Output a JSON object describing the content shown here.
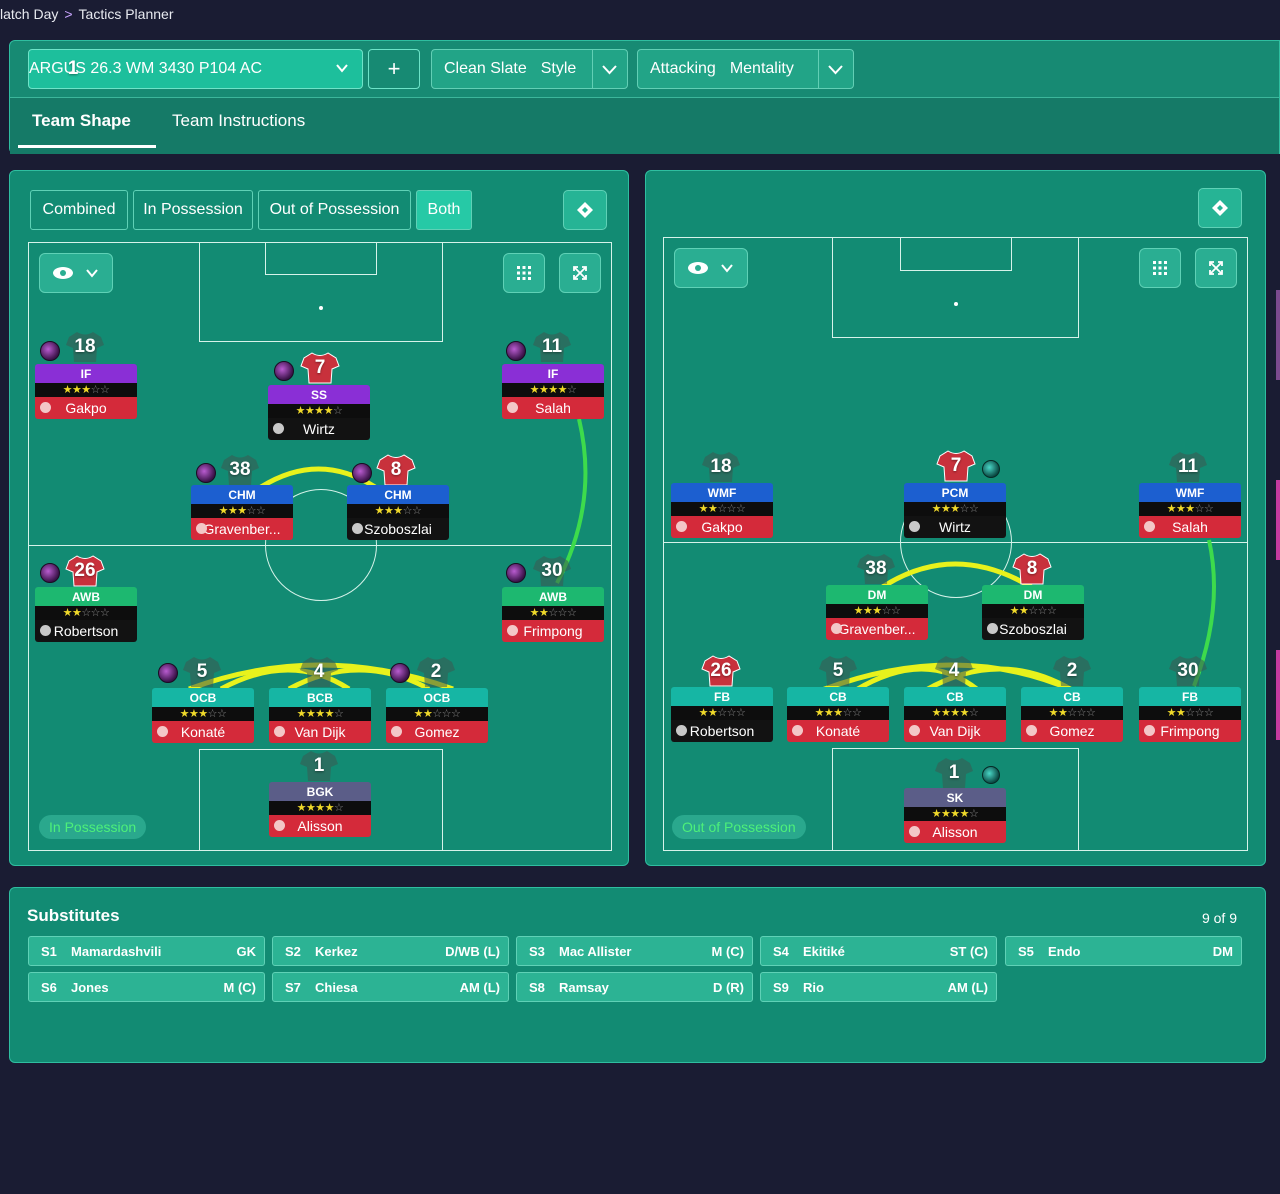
{
  "breadcrumb": {
    "parent": "latch Day",
    "current": "Tactics Planner"
  },
  "header": {
    "tactic_number": "1",
    "tactic_name": "ARGUS 26.3 WM  3430 P104 AC",
    "add_label": "+",
    "style_value": "Clean Slate",
    "style_label": "Style",
    "mentality_value": "Attacking",
    "mentality_label": "Mentality"
  },
  "tabs": {
    "team_shape": "Team Shape",
    "team_instructions": "Team Instructions"
  },
  "view_modes": [
    "Combined",
    "In Possession",
    "Out of Possession",
    "Both"
  ],
  "left_pitch": {
    "label": "In Possession",
    "players": [
      {
        "num": "18",
        "role": "IF",
        "stars": "★★★☆☆",
        "name": "Gakpo"
      },
      {
        "num": "7",
        "role": "SS",
        "stars": "★★★★☆",
        "name": "Wirtz"
      },
      {
        "num": "11",
        "role": "IF",
        "stars": "★★★★☆",
        "name": "Salah"
      },
      {
        "num": "38",
        "role": "CHM",
        "stars": "★★★☆☆",
        "name": "Gravenber..."
      },
      {
        "num": "8",
        "role": "CHM",
        "stars": "★★★☆☆",
        "name": "Szoboszlai"
      },
      {
        "num": "26",
        "role": "AWB",
        "stars": "★★☆☆☆",
        "name": "Robertson"
      },
      {
        "num": "30",
        "role": "AWB",
        "stars": "★★☆☆☆",
        "name": "Frimpong"
      },
      {
        "num": "5",
        "role": "OCB",
        "stars": "★★★☆☆",
        "name": "Konaté"
      },
      {
        "num": "4",
        "role": "BCB",
        "stars": "★★★★☆",
        "name": "Van Dijk"
      },
      {
        "num": "2",
        "role": "OCB",
        "stars": "★★☆☆☆",
        "name": "Gomez"
      },
      {
        "num": "1",
        "role": "BGK",
        "stars": "★★★★☆",
        "name": "Alisson"
      }
    ]
  },
  "right_pitch": {
    "label": "Out of Possession",
    "players": [
      {
        "num": "18",
        "role": "WMF",
        "stars": "★★☆☆☆",
        "name": "Gakpo"
      },
      {
        "num": "7",
        "role": "PCM",
        "stars": "★★★☆☆",
        "name": "Wirtz"
      },
      {
        "num": "11",
        "role": "WMF",
        "stars": "★★★☆☆",
        "name": "Salah"
      },
      {
        "num": "38",
        "role": "DM",
        "stars": "★★★☆☆",
        "name": "Gravenber..."
      },
      {
        "num": "8",
        "role": "DM",
        "stars": "★★☆☆☆",
        "name": "Szoboszlai"
      },
      {
        "num": "26",
        "role": "FB",
        "stars": "★★☆☆☆",
        "name": "Robertson"
      },
      {
        "num": "5",
        "role": "CB",
        "stars": "★★★☆☆",
        "name": "Konaté"
      },
      {
        "num": "4",
        "role": "CB",
        "stars": "★★★★☆",
        "name": "Van Dijk"
      },
      {
        "num": "2",
        "role": "CB",
        "stars": "★★☆☆☆",
        "name": "Gomez"
      },
      {
        "num": "30",
        "role": "FB",
        "stars": "★★☆☆☆",
        "name": "Frimpong"
      },
      {
        "num": "1",
        "role": "SK",
        "stars": "★★★★☆",
        "name": "Alisson"
      }
    ]
  },
  "substitutes": {
    "title": "Substitutes",
    "count": "9 of 9",
    "items": [
      {
        "slot": "S1",
        "name": "Mamardashvili",
        "pos": "GK"
      },
      {
        "slot": "S2",
        "name": "Kerkez",
        "pos": "D/WB (L)"
      },
      {
        "slot": "S3",
        "name": "Mac Allister",
        "pos": "M (C)"
      },
      {
        "slot": "S4",
        "name": "Ekitiké",
        "pos": "ST (C)"
      },
      {
        "slot": "S5",
        "name": "Endo",
        "pos": "DM"
      },
      {
        "slot": "S6",
        "name": "Jones",
        "pos": "M (C)"
      },
      {
        "slot": "S7",
        "name": "Chiesa",
        "pos": "AM (L)"
      },
      {
        "slot": "S8",
        "name": "Ramsay",
        "pos": "D (R)"
      },
      {
        "slot": "S9",
        "name": "Rio",
        "pos": "AM (L)"
      }
    ]
  },
  "colors": {
    "panel": "#128b73",
    "accent": "#26c9a6",
    "link_line": "#e8f21c",
    "edge_pink": "#c53aa0"
  }
}
